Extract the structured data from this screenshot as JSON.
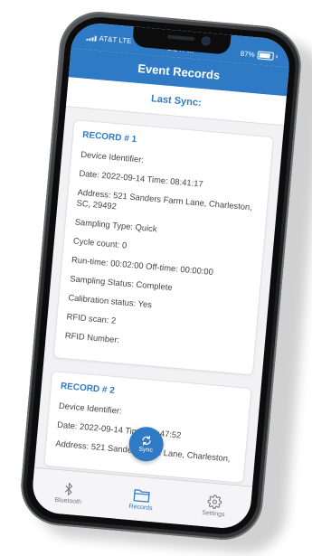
{
  "status": {
    "carrier": "AT&T LTE",
    "time": "9:24 AM",
    "battery": "87%",
    "battery_level": 0.87
  },
  "header": {
    "title": "Event Records"
  },
  "sync": {
    "label": "Last Sync:"
  },
  "records": [
    {
      "title": "RECORD # 1",
      "fields": [
        "Device Identifier:",
        "Date: 2022-09-14 Time: 08:41:17",
        "Address: 521 Sanders Farm Lane, Charleston, SC, 29492",
        "Sampling Type: Quick",
        "Cycle count: 0",
        "Run-time: 00:02:00 Off-time: 00:00:00",
        "Sampling Status: Complete",
        "Calibration status: Yes",
        "RFID scan: 2",
        "RFID Number:"
      ]
    },
    {
      "title": "RECORD # 2",
      "fields": [
        "Device Identifier:",
        "Date: 2022-09-14 Time: 08:47:52",
        "Address: 521 Sanders Farm Lane, Charleston,"
      ]
    }
  ],
  "sync_button": {
    "label": "Sync",
    "icon": "sync-icon"
  },
  "tabs": [
    {
      "label": "Bluetooth",
      "icon": "bluetooth-icon"
    },
    {
      "label": "Records",
      "icon": "folder-icon"
    },
    {
      "label": "Settings",
      "icon": "gear-icon"
    }
  ],
  "colors": {
    "accent": "#2f7ac5",
    "background": "#f2f2f4"
  }
}
